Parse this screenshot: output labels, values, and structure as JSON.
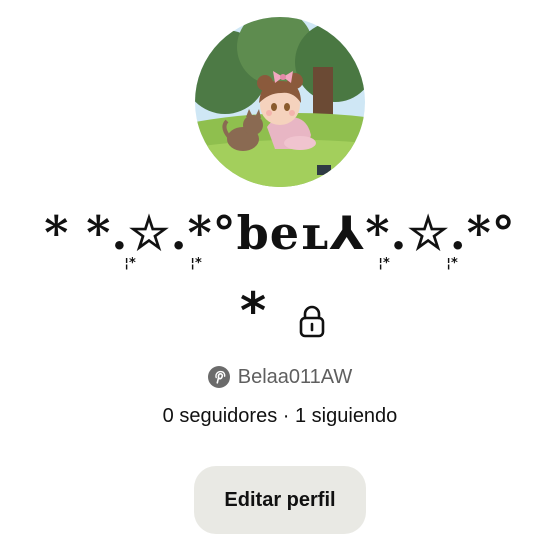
{
  "profile": {
    "name_line1": "* *.☆.*°bеʟ⅄*.☆.*°",
    "name_line2": "*",
    "sparkles": [
      "¦*",
      "¦*",
      "¦*",
      "¦*"
    ],
    "handle": "Belaa011AW",
    "followers": "0 seguidores",
    "separator": "·",
    "following": "1 siguiendo",
    "avatar_alt": "avatar",
    "lock_icon": "lock-icon",
    "brand_icon": "pinterest-icon"
  },
  "actions": {
    "edit_label": "Editar perfil"
  },
  "colors": {
    "button_bg": "#e9e9e4",
    "handle_text": "#5f5f5f",
    "brand_icon": "#6b6b6b"
  }
}
